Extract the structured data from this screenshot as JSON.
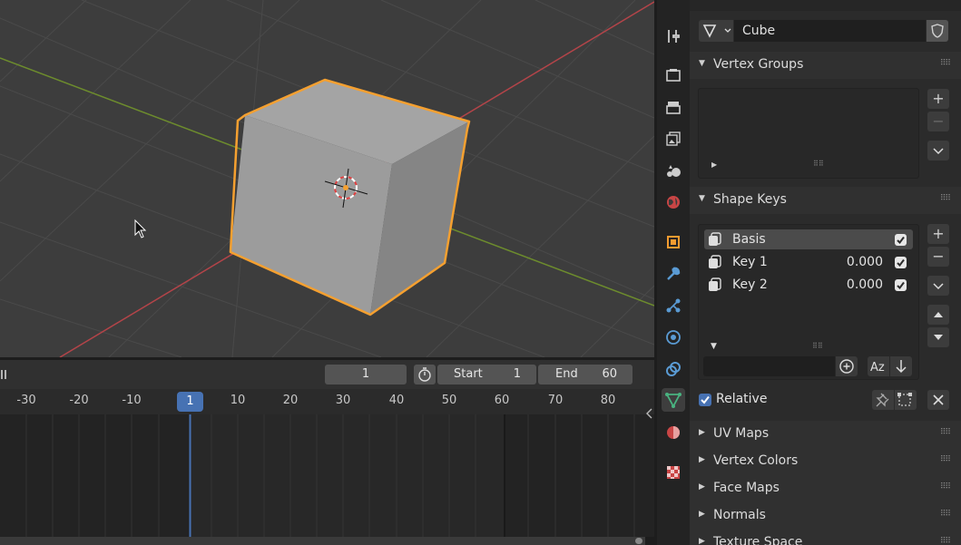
{
  "object": {
    "mesh_name": "Cube"
  },
  "panels": {
    "vertex_groups": "Vertex Groups",
    "shape_keys": "Shape Keys",
    "uv_maps": "UV Maps",
    "vertex_colors": "Vertex Colors",
    "face_maps": "Face Maps",
    "normals": "Normals",
    "texture_space": "Texture Space"
  },
  "shape_keys": [
    {
      "name": "Basis",
      "value": "",
      "checked": true
    },
    {
      "name": "Key 1",
      "value": "0.000",
      "checked": true
    },
    {
      "name": "Key 2",
      "value": "0.000",
      "checked": true
    }
  ],
  "relative": {
    "label": "Relative",
    "checked": true
  },
  "timeline": {
    "current_frame": "1",
    "start_label": "Start",
    "start_value": "1",
    "end_label": "End",
    "end_value": "60",
    "ticks": [
      "-30",
      "-20",
      "-10",
      "1",
      "10",
      "20",
      "30",
      "40",
      "50",
      "60",
      "70",
      "80"
    ],
    "playhead": "1"
  },
  "colors": {
    "selection_outline": "#f5a030",
    "active_blue": "#4772b3",
    "x_axis": "#b34449",
    "y_axis": "#6d8c2d",
    "mesh_tab_green": "#49b380"
  },
  "property_tabs": [
    "tool-icon",
    "render-icon",
    "output-icon",
    "view-layer-icon",
    "scene-icon",
    "world-icon",
    "object-icon",
    "modifier-icon",
    "particles-icon",
    "physics-icon",
    "constraints-icon",
    "data-icon",
    "material-icon",
    "texture-icon"
  ]
}
